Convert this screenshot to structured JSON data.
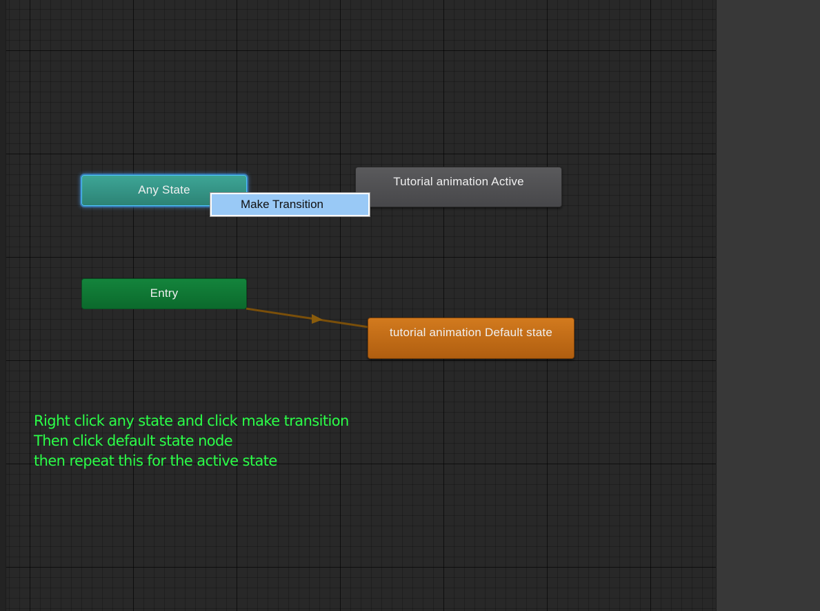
{
  "graph": {
    "nodes": {
      "any_state": {
        "label": "Any State"
      },
      "entry": {
        "label": "Entry"
      },
      "active": {
        "label": "Tutorial animation Active"
      },
      "default": {
        "label": "tutorial animation Default state"
      }
    },
    "context_menu": {
      "items": [
        {
          "label": "Make Transition"
        }
      ]
    },
    "colors": {
      "any_state": "#2d8375",
      "entry": "#0b6a2c",
      "active": "#47474a",
      "default": "#b05e10",
      "transition": "#7a4f0a",
      "annotation": "#2bff48"
    }
  },
  "annotation": {
    "lines": [
      "Right click any state and click make transition",
      "Then click default state node",
      "then repeat this for the active state"
    ]
  }
}
